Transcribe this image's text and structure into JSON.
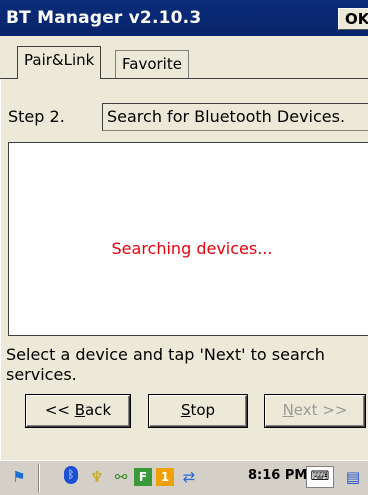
{
  "window": {
    "title": "BT Manager v2.10.3",
    "ok_label": "OK"
  },
  "tabs": [
    {
      "label": "Pair&Link",
      "active": true
    },
    {
      "label": "Favorite",
      "active": false
    }
  ],
  "step": {
    "label": "Step 2.",
    "description": "Search for Bluetooth Devices."
  },
  "device_list": {
    "status": "Searching devices..."
  },
  "hint": "Select a device and tap 'Next' to search services.",
  "buttons": {
    "back_prefix": "<< ",
    "back_key": "B",
    "back_rest": "ack",
    "stop_key": "S",
    "stop_rest": "top",
    "next_key": "N",
    "next_rest": "ext >>",
    "next_enabled": false
  },
  "taskbar": {
    "clock": "8:16 PM",
    "tray_icons": [
      "start-flag-icon",
      "bluetooth-icon",
      "network-icon",
      "usb-icon",
      "f-icon",
      "1-icon",
      "sync-icon",
      "keyboard-icon",
      "input-icon"
    ]
  },
  "colors": {
    "titlebar": "#0a246a",
    "status_text": "#e8000b",
    "disabled_text": "#9a9a9a"
  }
}
